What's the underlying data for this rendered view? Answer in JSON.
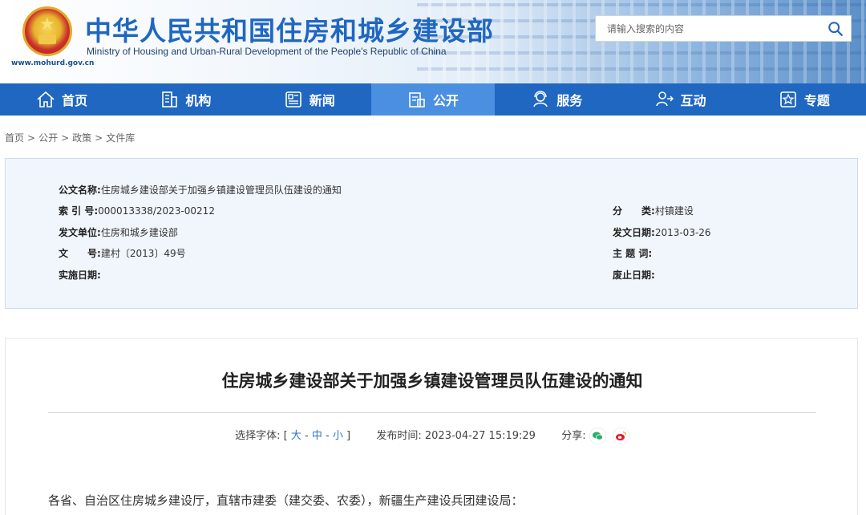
{
  "header": {
    "site_title": "中华人民共和国住房和城乡建设部",
    "site_subtitle": "Ministry of Housing and Urban-Rural Development of the People's Republic of China",
    "site_url": "www.mohurd.gov.cn",
    "search_placeholder": "请输入搜索的内容"
  },
  "nav": {
    "items": [
      {
        "label": "首页",
        "icon": "home-icon"
      },
      {
        "label": "机构",
        "icon": "building-icon"
      },
      {
        "label": "新闻",
        "icon": "news-icon"
      },
      {
        "label": "公开",
        "icon": "public-icon",
        "active": true
      },
      {
        "label": "服务",
        "icon": "service-icon"
      },
      {
        "label": "互动",
        "icon": "interaction-icon"
      },
      {
        "label": "专题",
        "icon": "topic-icon"
      }
    ]
  },
  "breadcrumb": [
    "首页",
    "公开",
    "政策",
    "文件库"
  ],
  "meta": {
    "doc_name_label": "公文名称:",
    "doc_name": "住房城乡建设部关于加强乡镇建设管理员队伍建设的通知",
    "index_label": "索 引 号:",
    "index": "000013338/2023-00212",
    "category_label": "分　　类:",
    "category": "村镇建设",
    "issuer_label": "发文单位:",
    "issuer": "住房和城乡建设部",
    "issue_date_label": "发文日期:",
    "issue_date": "2013-03-26",
    "doc_no_label": "文　　号:",
    "doc_no": "建村〔2013〕49号",
    "keywords_label": "主 题 词:",
    "keywords": "",
    "effective_label": "实施日期:",
    "effective": "",
    "abolish_label": "废止日期:",
    "abolish": ""
  },
  "article": {
    "title": "住房城乡建设部关于加强乡镇建设管理员队伍建设的通知",
    "font_label": "选择字体:",
    "font_open": "[",
    "font_large": "大",
    "font_medium": "中",
    "font_small": "小",
    "font_close": "]",
    "dash": "-",
    "publish_label": "发布时间:",
    "publish_time": "2023-04-27 15:19:29",
    "share_label": "分享:",
    "body_first_line": "各省、自治区住房城乡建设厅，直辖市建委（建交委、农委），新疆生产建设兵团建设局："
  }
}
